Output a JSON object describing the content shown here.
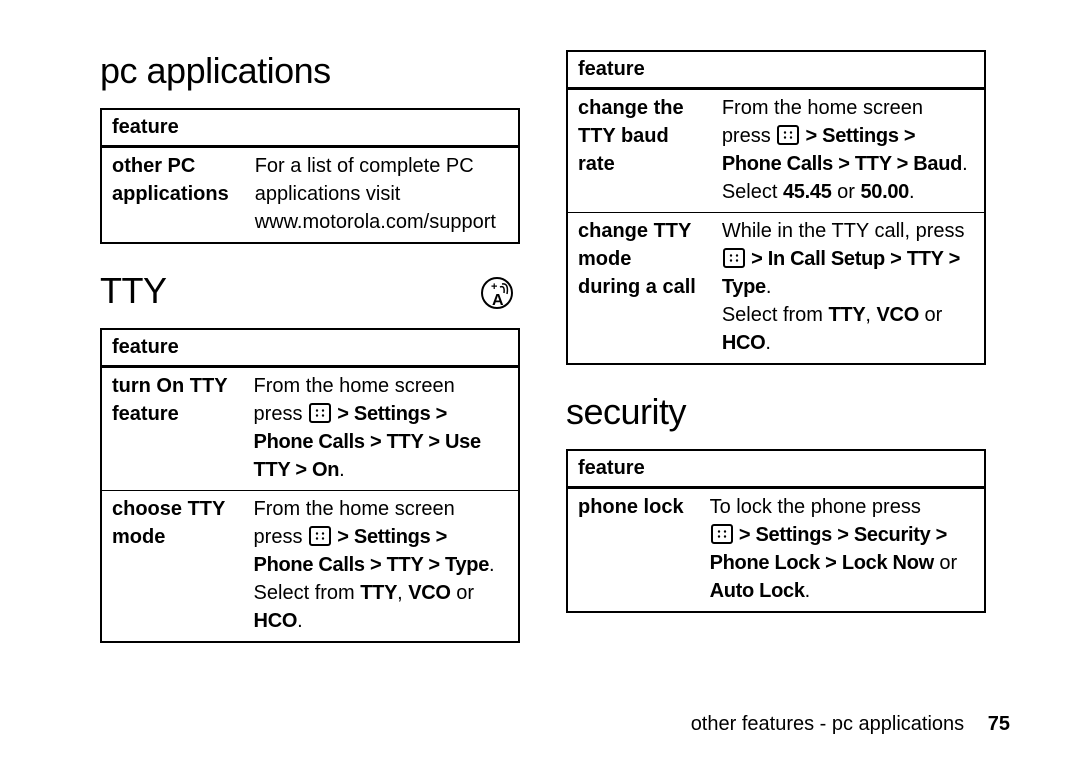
{
  "left": {
    "section1_title": "pc applications",
    "table1_header": "feature",
    "table1": {
      "r0_k1": "other PC",
      "r0_k2": "applications",
      "r0_v1": "For a list of complete PC",
      "r0_v2": "applications visit",
      "r0_v3": "www.motorola.com/support"
    },
    "section2_title": "TTY",
    "table2_header": "feature",
    "table2": {
      "r0_k1": "turn On TTY",
      "r0_k2": "feature",
      "r0_v1": "From the home screen",
      "r0_v2a": "press ",
      "r0_v2b": " > Settings >",
      "r0_v3": "Phone Calls > TTY > Use TTY > On",
      "r0_v3p": ".",
      "r1_k1": "choose TTY",
      "r1_k2": "mode",
      "r1_v1": "From the home screen",
      "r1_v2a": "press ",
      "r1_v2b": " > Settings >",
      "r1_v3": "Phone Calls > TTY > Type",
      "r1_v3p": ".",
      "r1_v4a": "Select from ",
      "r1_v4b": "TTY",
      "r1_v4c": ", ",
      "r1_v4d": "VCO",
      "r1_v4e": " or ",
      "r1_v4f": "HCO",
      "r1_v4g": "."
    }
  },
  "right": {
    "table3_header": "feature",
    "table3": {
      "r0_k1": "change the",
      "r0_k2": "TTY baud",
      "r0_k3": "rate",
      "r0_v1": "From the home screen",
      "r0_v2a": "press ",
      "r0_v2b": " > Settings >",
      "r0_v3": "Phone Calls > TTY > Baud",
      "r0_v3p": ".",
      "r0_v4a": "Select ",
      "r0_v4b": "45.45",
      "r0_v4c": " or ",
      "r0_v4d": "50.00",
      "r0_v4e": ".",
      "r1_k1": "change TTY",
      "r1_k2": "mode",
      "r1_k3": "during a call",
      "r1_v1": "While in the TTY call, press",
      "r1_v2b": " > In Call Setup > TTY > Type",
      "r1_v2p": ".",
      "r1_v3a": "Select from ",
      "r1_v3b": "TTY",
      "r1_v3c": ", ",
      "r1_v3d": "VCO",
      "r1_v3e": " or ",
      "r1_v3f": "HCO",
      "r1_v3g": "."
    },
    "section_title": "security",
    "table4_header": "feature",
    "table4": {
      "r0_k1": "phone lock",
      "r0_v1": "To lock the phone press",
      "r0_v2b": " > Settings > Security >",
      "r0_v3a": "Phone Lock > Lock Now",
      "r0_v3b": " or",
      "r0_v4": "Auto Lock",
      "r0_v4p": "."
    }
  },
  "footer": {
    "text": "other features - pc applications",
    "page": "75"
  }
}
